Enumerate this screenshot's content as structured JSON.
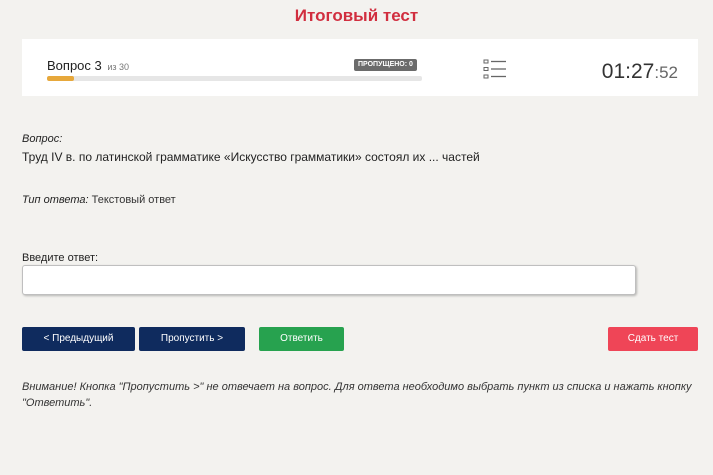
{
  "page": {
    "title": "Итоговый тест"
  },
  "header": {
    "question_label": "Вопрос 3",
    "question_of": "из 30",
    "skipped_badge": "ПРОПУЩЕНО: 0",
    "progress_fraction": 0.073,
    "timer_main": "01:27",
    "timer_seconds": ":52",
    "list_icon": "list-icon"
  },
  "question": {
    "label": "Вопрос:",
    "text": "Труд IV в. по латинской грамматике «Искусство грамматики» состоял их ... частей"
  },
  "answer_type": {
    "label": "Тип ответа:",
    "value": "Текстовый ответ"
  },
  "answer_input": {
    "label": "Введите ответ:",
    "value": "",
    "placeholder": ""
  },
  "buttons": {
    "prev": "< Предыдущий",
    "skip": "Пропустить >",
    "answer": "Ответить",
    "submit": "Сдать тест"
  },
  "colors": {
    "title": "#d12e3f",
    "nav_button": "#0f2b5e",
    "answer_button": "#27a24f",
    "submit_button": "#ef4557",
    "progress": "#e7a83b"
  },
  "warning": "Внимание! Кнопка \"Пропустить >\" не отвечает на вопрос. Для ответа необходимо выбрать пункт из списка и нажать кнопку \"Ответить\"."
}
